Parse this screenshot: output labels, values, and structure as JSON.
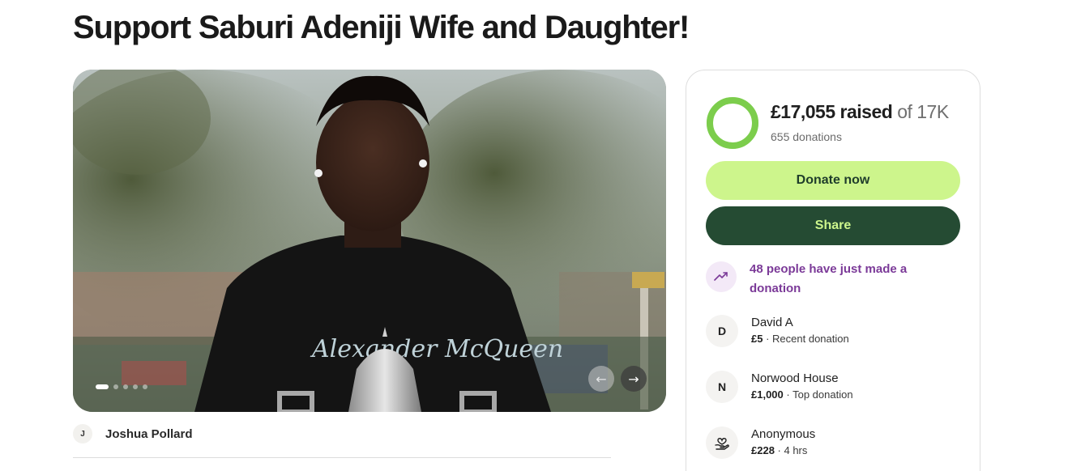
{
  "page": {
    "title": "Support Saburi Adeniji Wife and Daughter!"
  },
  "gallery": {
    "slide_count": 5,
    "active_slide": 1,
    "prev_icon": "←",
    "next_icon": "→",
    "photo_text": "Alexander McQueen"
  },
  "organiser": {
    "initial": "J",
    "name": "Joshua Pollard"
  },
  "progress": {
    "amount": "£17,055 raised",
    "of": "of 17K",
    "donations": "655 donations",
    "fraction": 1.0,
    "ring_color": "#7ccd4c",
    "ring_track": "#c7ecb0"
  },
  "actions": {
    "donate_label": "Donate now",
    "share_label": "Share"
  },
  "activity": {
    "text": "48 people have just made a donation",
    "icon": "trending-up-icon"
  },
  "donations": [
    {
      "avatar": "D",
      "name": "David A",
      "amount": "£5",
      "detail": "Recent donation"
    },
    {
      "avatar": "N",
      "name": "Norwood House",
      "amount": "£1,000",
      "detail": "Top donation"
    },
    {
      "avatar": "",
      "avatar_icon": "heart-hand-icon",
      "name": "Anonymous",
      "amount": "£228",
      "detail": "4 hrs"
    }
  ],
  "colors": {
    "accent_green": "#cdf58c",
    "dark_green": "#254b33",
    "purple": "#7b3a98"
  }
}
